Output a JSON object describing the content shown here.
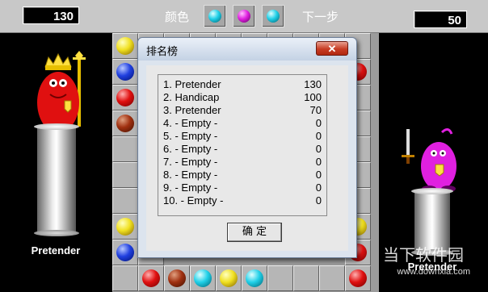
{
  "header": {
    "score_left": "130",
    "color_label": "颜色",
    "next_label": "下一步",
    "score_right": "50",
    "slot_colors": [
      "cyan",
      "magenta",
      "cyan"
    ]
  },
  "left_player": {
    "name": "Pretender"
  },
  "right_player": {
    "name": "Pretender"
  },
  "dialog": {
    "title": "排名榜",
    "close_label": "✕",
    "ok_label": "确 定",
    "rows": [
      {
        "name": "1. Pretender",
        "score": "130"
      },
      {
        "name": "2. Handicap",
        "score": "100"
      },
      {
        "name": "3. Pretender",
        "score": "70"
      },
      {
        "name": "4. - Empty -",
        "score": "0"
      },
      {
        "name": "5. - Empty -",
        "score": "0"
      },
      {
        "name": "6. - Empty -",
        "score": "0"
      },
      {
        "name": "7. - Empty -",
        "score": "0"
      },
      {
        "name": "8. - Empty -",
        "score": "0"
      },
      {
        "name": "9. - Empty -",
        "score": "0"
      },
      {
        "name": "10. - Empty -",
        "score": "0"
      }
    ]
  },
  "watermark": {
    "line1": "当下软件园",
    "line2": "www.downxia.com"
  },
  "colors": {
    "board": "#9c9c9c",
    "dialog_bg": "#dce4ee",
    "close_red": "#c83c24"
  }
}
